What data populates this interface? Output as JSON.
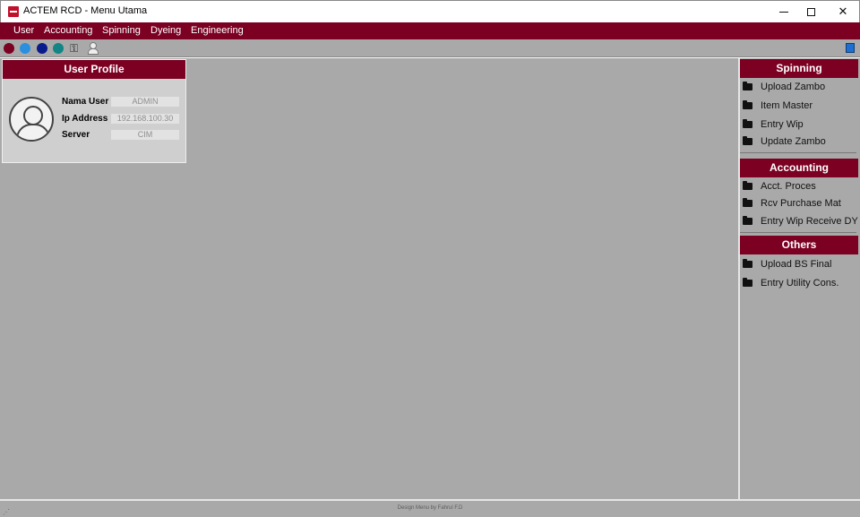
{
  "window": {
    "title": "ACTEM RCD - Menu Utama",
    "minimize": "minimize",
    "maximize": "maximize",
    "close": "✕"
  },
  "menubar": {
    "items": [
      "User",
      "Accounting",
      "Spinning",
      "Dyeing",
      "Engineering"
    ]
  },
  "toolbar": {
    "dots": [
      "#7b0022",
      "#2b8fe0",
      "#0a1a8a",
      "#138585"
    ],
    "key_icon": "key-icon",
    "user_icon": "user-icon",
    "window_icon": "window-icon"
  },
  "profile": {
    "title": "User Profile",
    "fields": [
      {
        "label": "Nama User",
        "value": "ADMIN"
      },
      {
        "label": "Ip Address",
        "value": "192.168.100.30"
      },
      {
        "label": "Server",
        "value": "CIM"
      }
    ]
  },
  "sidebar": {
    "sections": [
      {
        "title": "Spinning",
        "items": [
          "Upload Zambo",
          "Item Master",
          "Entry Wip",
          "Update Zambo"
        ]
      },
      {
        "title": "Accounting",
        "items": [
          "Acct. Proces",
          "Rcv Purchase Mat",
          "Entry Wip Receive DY"
        ]
      },
      {
        "title": "Others",
        "items": [
          "Upload BS Final",
          "Entry Utility Cons."
        ]
      }
    ]
  },
  "status": {
    "text": "Design Menu by Fahrul F.D"
  },
  "colors": {
    "accent": "#7b0022",
    "panel": "#a9a9a9"
  }
}
